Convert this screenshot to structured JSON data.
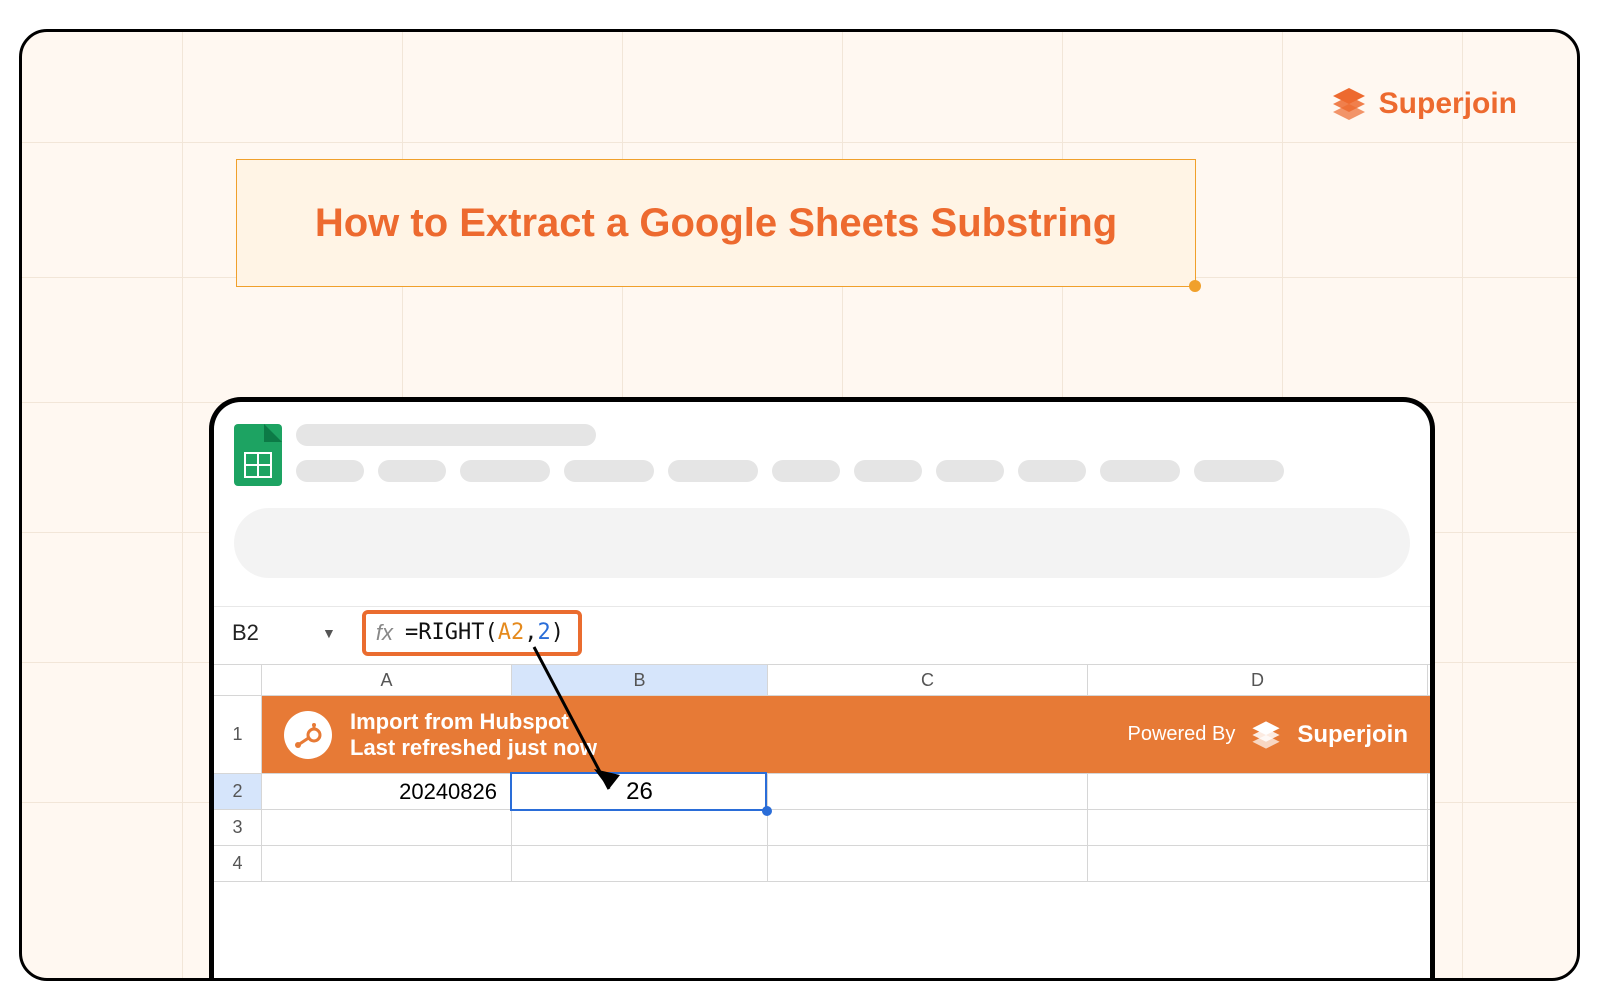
{
  "brand": "Superjoin",
  "title": "How to Extract a Google Sheets Substring",
  "formula": {
    "cell_ref": "B2",
    "prefix": "=RIGHT(",
    "arg_ref": "A2",
    "comma": ",",
    "arg_num": "2",
    "suffix": ")"
  },
  "columns": {
    "A": "A",
    "B": "B",
    "C": "C",
    "D": "D"
  },
  "rows": {
    "r1": "1",
    "r2": "2",
    "r3": "3",
    "r4": "4"
  },
  "banner": {
    "line1": "Import from Hubspot",
    "line2": "Last refreshed just now",
    "powered": "Powered By",
    "brand": "Superjoin"
  },
  "values": {
    "A2": "20240826",
    "B2": "26"
  }
}
